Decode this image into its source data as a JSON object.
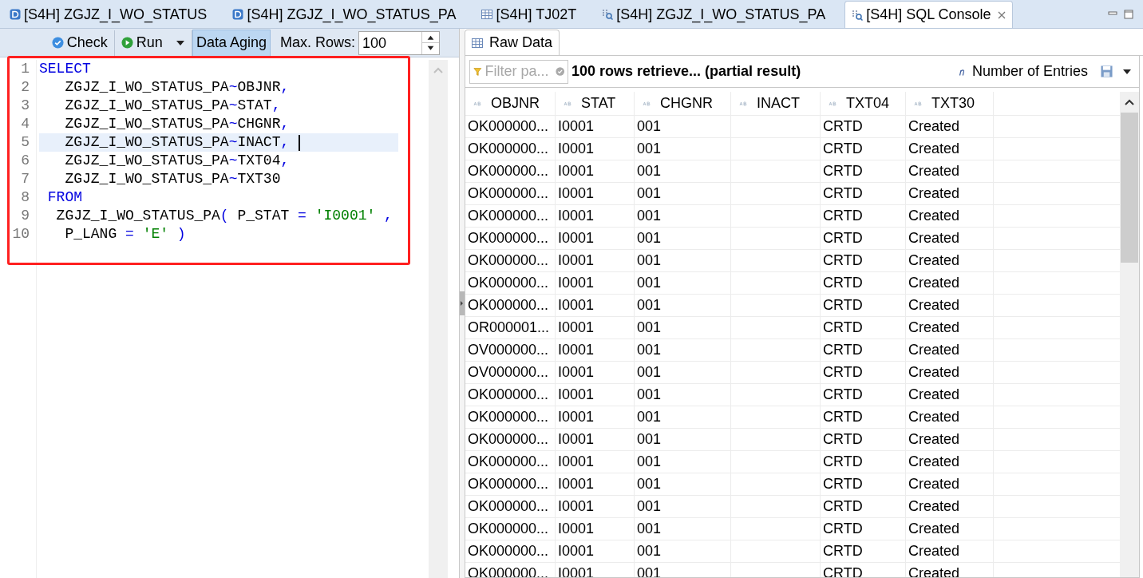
{
  "tabs": [
    {
      "label": "[S4H] ZGJZ_I_WO_STATUS",
      "kind": "ddl",
      "selected": false,
      "closable": false
    },
    {
      "label": "[S4H] ZGJZ_I_WO_STATUS_PA",
      "kind": "ddl",
      "selected": false,
      "closable": false
    },
    {
      "label": "[S4H] TJ02T",
      "kind": "table",
      "selected": false,
      "closable": false
    },
    {
      "label": "[S4H] ZGJZ_I_WO_STATUS_PA",
      "kind": "console",
      "selected": false,
      "closable": false
    },
    {
      "label": "[S4H] SQL Console",
      "kind": "console",
      "selected": true,
      "closable": true
    }
  ],
  "toolbar": {
    "check": "Check",
    "run": "Run",
    "data_aging": {
      "label": "Data Aging",
      "on": true
    },
    "max_rows_label": "Max. Rows:",
    "max_rows": "100"
  },
  "editor": {
    "lines": [
      {
        "number": "1",
        "current": false,
        "tokens": [
          {
            "kind": "keyword",
            "text": "SELECT"
          }
        ]
      },
      {
        "number": "2",
        "current": false,
        "tokens": [
          {
            "kind": "ident",
            "text": "   ZGJZ_I_WO_STATUS_PA"
          },
          {
            "kind": "op",
            "text": "~"
          },
          {
            "kind": "ident",
            "text": "OBJNR"
          },
          {
            "kind": "op",
            "text": ","
          }
        ]
      },
      {
        "number": "3",
        "current": false,
        "tokens": [
          {
            "kind": "ident",
            "text": "   ZGJZ_I_WO_STATUS_PA"
          },
          {
            "kind": "op",
            "text": "~"
          },
          {
            "kind": "ident",
            "text": "STAT"
          },
          {
            "kind": "op",
            "text": ","
          }
        ]
      },
      {
        "number": "4",
        "current": false,
        "tokens": [
          {
            "kind": "ident",
            "text": "   ZGJZ_I_WO_STATUS_PA"
          },
          {
            "kind": "op",
            "text": "~"
          },
          {
            "kind": "ident",
            "text": "CHGNR"
          },
          {
            "kind": "op",
            "text": ","
          }
        ]
      },
      {
        "number": "5",
        "current": true,
        "tokens": [
          {
            "kind": "ident",
            "text": "   ZGJZ_I_WO_STATUS_PA"
          },
          {
            "kind": "op",
            "text": "~"
          },
          {
            "kind": "ident",
            "text": "INACT"
          },
          {
            "kind": "op",
            "text": ","
          }
        ]
      },
      {
        "number": "6",
        "current": false,
        "tokens": [
          {
            "kind": "ident",
            "text": "   ZGJZ_I_WO_STATUS_PA"
          },
          {
            "kind": "op",
            "text": "~"
          },
          {
            "kind": "ident",
            "text": "TXT04"
          },
          {
            "kind": "op",
            "text": ","
          }
        ]
      },
      {
        "number": "7",
        "current": false,
        "tokens": [
          {
            "kind": "ident",
            "text": "   ZGJZ_I_WO_STATUS_PA"
          },
          {
            "kind": "op",
            "text": "~"
          },
          {
            "kind": "ident",
            "text": "TXT30"
          }
        ]
      },
      {
        "number": "8",
        "current": false,
        "tokens": [
          {
            "kind": "keyword",
            "text": " FROM"
          }
        ]
      },
      {
        "number": "9",
        "current": false,
        "tokens": [
          {
            "kind": "ident",
            "text": "  ZGJZ_I_WO_STATUS_PA"
          },
          {
            "kind": "op",
            "text": "("
          },
          {
            "kind": "ident",
            "text": " P_STAT "
          },
          {
            "kind": "op",
            "text": "="
          },
          {
            "kind": "string",
            "text": " 'I0001' "
          },
          {
            "kind": "op",
            "text": ","
          }
        ]
      },
      {
        "number": "10",
        "current": false,
        "tokens": [
          {
            "kind": "ident",
            "text": "   P_LANG "
          },
          {
            "kind": "op",
            "text": "="
          },
          {
            "kind": "string",
            "text": " 'E' "
          },
          {
            "kind": "op",
            "text": ")"
          }
        ]
      }
    ]
  },
  "results": {
    "tab": "Raw Data",
    "filter": {
      "placeholder": "Filter pa..."
    },
    "status": "100 rows retrieve... (partial result)",
    "count_button": "Number of Entries",
    "columns": [
      "OBJNR",
      "STAT",
      "CHGNR",
      "INACT",
      "TXT04",
      "TXT30"
    ],
    "rows": [
      [
        "OK000000...",
        "I0001",
        "001",
        "",
        "CRTD",
        "Created"
      ],
      [
        "OK000000...",
        "I0001",
        "001",
        "",
        "CRTD",
        "Created"
      ],
      [
        "OK000000...",
        "I0001",
        "001",
        "",
        "CRTD",
        "Created"
      ],
      [
        "OK000000...",
        "I0001",
        "001",
        "",
        "CRTD",
        "Created"
      ],
      [
        "OK000000...",
        "I0001",
        "001",
        "",
        "CRTD",
        "Created"
      ],
      [
        "OK000000...",
        "I0001",
        "001",
        "",
        "CRTD",
        "Created"
      ],
      [
        "OK000000...",
        "I0001",
        "001",
        "",
        "CRTD",
        "Created"
      ],
      [
        "OK000000...",
        "I0001",
        "001",
        "",
        "CRTD",
        "Created"
      ],
      [
        "OK000000...",
        "I0001",
        "001",
        "",
        "CRTD",
        "Created"
      ],
      [
        "OR000001...",
        "I0001",
        "001",
        "",
        "CRTD",
        "Created"
      ],
      [
        "OV000000...",
        "I0001",
        "001",
        "",
        "CRTD",
        "Created"
      ],
      [
        "OV000000...",
        "I0001",
        "001",
        "",
        "CRTD",
        "Created"
      ],
      [
        "OK000000...",
        "I0001",
        "001",
        "",
        "CRTD",
        "Created"
      ],
      [
        "OK000000...",
        "I0001",
        "001",
        "",
        "CRTD",
        "Created"
      ],
      [
        "OK000000...",
        "I0001",
        "001",
        "",
        "CRTD",
        "Created"
      ],
      [
        "OK000000...",
        "I0001",
        "001",
        "",
        "CRTD",
        "Created"
      ],
      [
        "OK000000...",
        "I0001",
        "001",
        "",
        "CRTD",
        "Created"
      ],
      [
        "OK000000...",
        "I0001",
        "001",
        "",
        "CRTD",
        "Created"
      ],
      [
        "OK000000...",
        "I0001",
        "001",
        "",
        "CRTD",
        "Created"
      ],
      [
        "OK000000...",
        "I0001",
        "001",
        "",
        "CRTD",
        "Created"
      ],
      [
        "OK000000...",
        "I0001",
        "001",
        "",
        "CRTD",
        "Created"
      ]
    ]
  }
}
